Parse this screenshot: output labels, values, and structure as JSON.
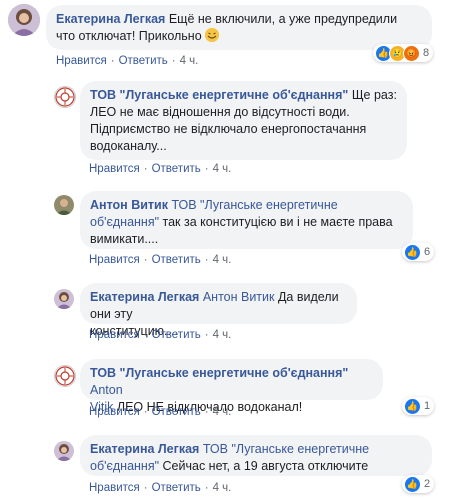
{
  "comments": [
    {
      "author": "Екатерина Легкая",
      "text_line1": " Ещё не включили, а уже предупредили",
      "text_line2": "что отключат! Прикольно ",
      "reaction_count": "8",
      "like": "Нравится",
      "reply": "Ответить",
      "time": "4 ч."
    },
    {
      "author": "ТОВ \"Луганське енергетичне об'єднання\"",
      "text_line1": " Ще раз:",
      "text_line2": "ЛЕО не має відношення до відсутності води.",
      "text_line3": "Підприємство не відключало енергопостачання",
      "text_line4": "водоканалу...",
      "like": "Нравится",
      "reply": "Ответить",
      "time": "4 ч."
    },
    {
      "author": "Антон Витик",
      "mention1": " ТОВ \"Луганське енергетичне",
      "mention2": "об'єднання\"",
      "text_line2": " так за конституцією ви і не маєте права",
      "text_line3": "вимикати....",
      "reaction_count": "6",
      "like": "Нравится",
      "reply": "Ответить",
      "time": "4 ч."
    },
    {
      "author": "Екатерина Легкая",
      "mention": " Антон Витик",
      "text_line1": " Да видели они эту",
      "text_line2": "конституцию....",
      "like": "Нравится",
      "reply": "Ответить",
      "time": "4 ч."
    },
    {
      "author": "ТОВ \"Луганське енергетичне об'єднання\"",
      "mention1": " Anton",
      "mention2": "Vitik",
      "text_line2": " ЛЕО НЕ відключало водоканал!",
      "reaction_count": "1",
      "like": "Нравится",
      "reply": "Ответить",
      "time": "4 ч."
    },
    {
      "author": "Екатерина Легкая",
      "mention1": " ТОВ \"Луганське енергетичне",
      "mention2": "об'єднання\"",
      "text_line2": " Сейчас нет, а 19 августа отключите",
      "reaction_count": "2",
      "like": "Нравится",
      "reply": "Ответить",
      "time": "4 ч."
    }
  ],
  "separator": "·",
  "colors": {
    "link": "#385898",
    "bubble": "#f2f3f5",
    "like_blue": "#1877f2"
  },
  "icons": [
    "woman-avatar",
    "leo-logo-avatar",
    "man-avatar",
    "like-icon",
    "sad-icon",
    "angry-icon",
    "laughing-emoji"
  ]
}
